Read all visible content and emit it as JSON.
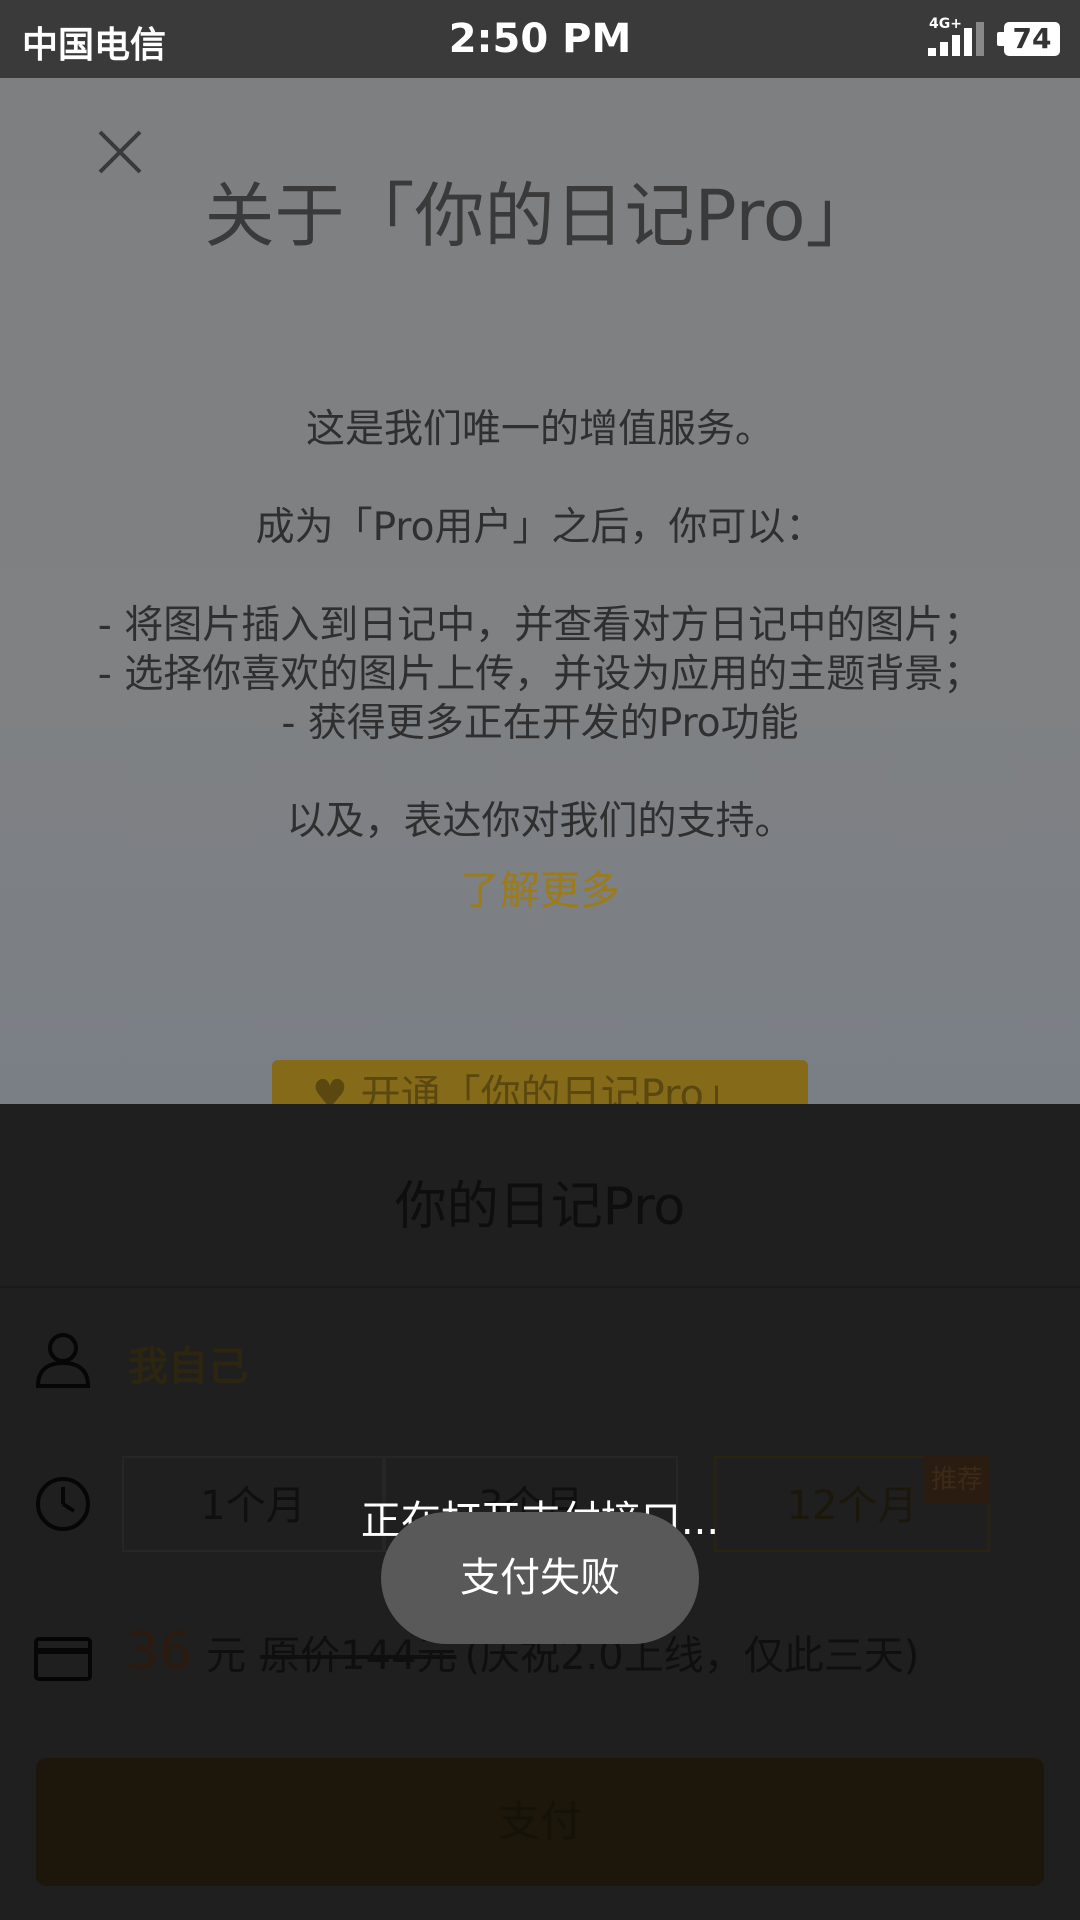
{
  "status_bar": {
    "carrier": "中国电信",
    "time": "2:50 PM",
    "network": "4G+",
    "battery": "74"
  },
  "about": {
    "title": "关于「你的日记Pro」",
    "lines": [
      "这是我们唯一的增值服务。",
      "成为「Pro用户」之后，你可以：",
      "- 将图片插入到日记中，并查看对方日记中的图片；",
      "- 选择你喜欢的图片上传，并设为应用的主题背景；",
      "- 获得更多正在开发的Pro功能",
      "以及，表达你对我们的支持。"
    ],
    "learn_more": "了解更多",
    "open_button": "开通「你的日记Pro」"
  },
  "purchase_sheet": {
    "title": "你的日记Pro",
    "recipient": "我自己",
    "durations": [
      "1个月",
      "3个月",
      "12个月"
    ],
    "selected_duration": "12个月",
    "recommended_badge": "推荐",
    "price": {
      "amount": "36",
      "unit": "元",
      "original": "原价144元",
      "note": "(庆祝2.0上线，仅此三天)"
    },
    "pay_button": "支付"
  },
  "toasts": {
    "opening": "正在打开支付接口...",
    "failure": "支付失败"
  },
  "colors": {
    "accent_gold": "#9c7b1a",
    "sheet_background": "#1f1f1f",
    "toast_background": "#595959"
  }
}
